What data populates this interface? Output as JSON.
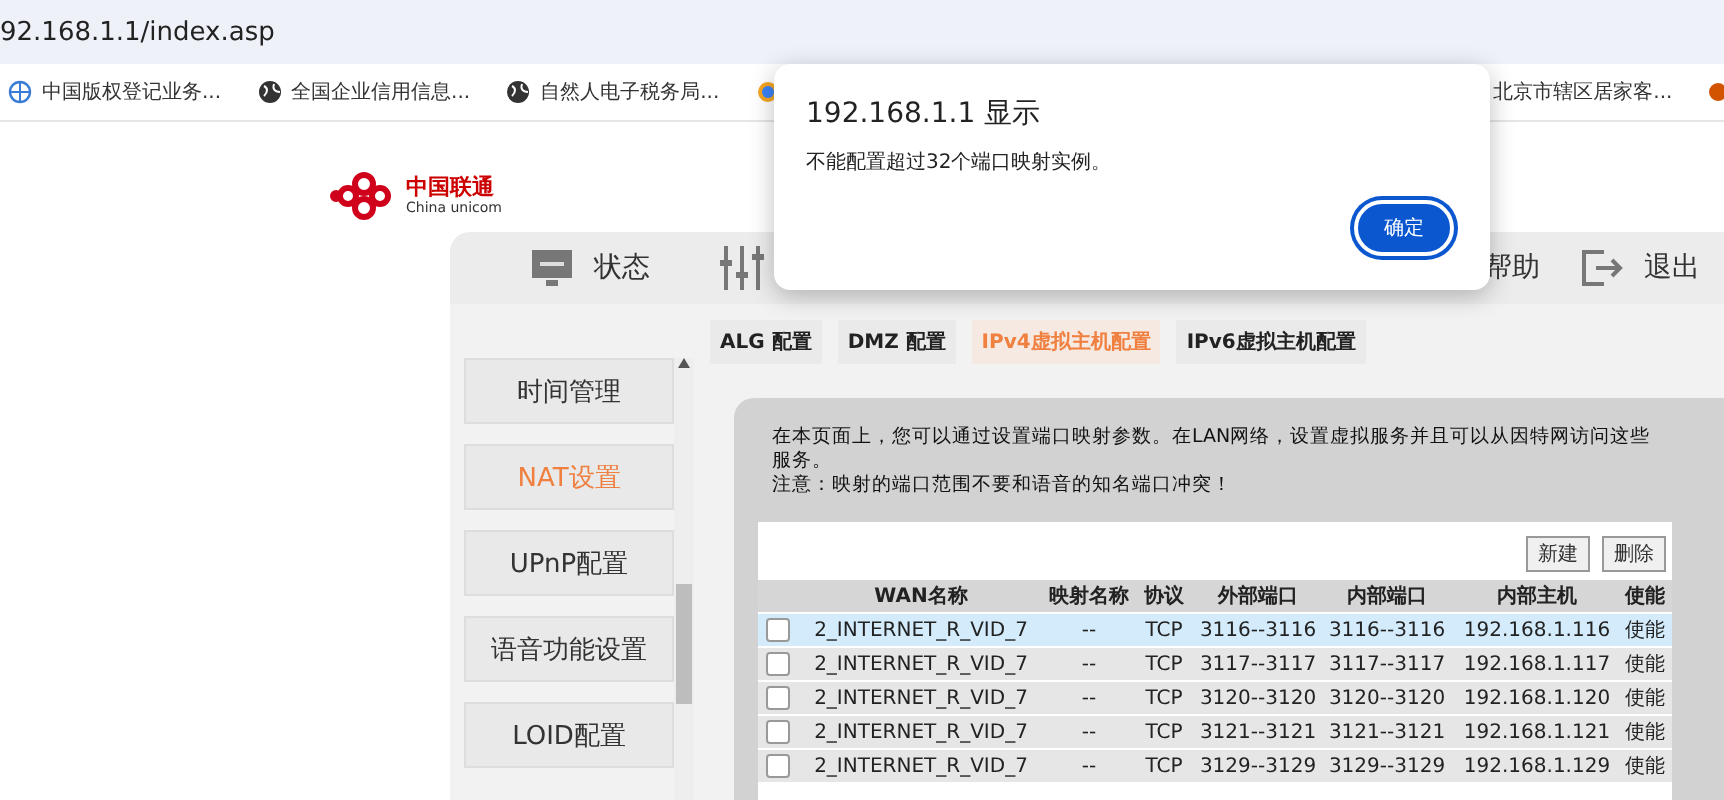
{
  "browser": {
    "url": "92.168.1.1/index.asp",
    "bookmarks": [
      {
        "kind": "globe-blue",
        "label": "中国版权登记业务..."
      },
      {
        "kind": "globe",
        "label": "全国企业信用信息..."
      },
      {
        "kind": "globe",
        "label": "自然人电子税务局..."
      },
      {
        "kind": "swirl"
      },
      {
        "kind": "flower",
        "label": "北京市辖区居家客..."
      },
      {
        "kind": "dot"
      }
    ]
  },
  "brand": {
    "name": "中国联通",
    "subtitle": "China unicom"
  },
  "nav": [
    {
      "kind": "monitor",
      "label": "状态"
    },
    {
      "kind": "sliders"
    },
    {
      "kind": "plain",
      "label": "帮助"
    },
    {
      "kind": "exit",
      "label": "退出"
    }
  ],
  "subtabs": [
    {
      "label": "ALG 配置",
      "selected": false
    },
    {
      "label": "DMZ 配置",
      "selected": false
    },
    {
      "label": "IPv4虚拟主机配置",
      "selected": true
    },
    {
      "label": "IPv6虚拟主机配置",
      "selected": false
    }
  ],
  "sidebar": {
    "items": [
      {
        "label": "时间管理",
        "selected": false
      },
      {
        "label": "NAT设置",
        "selected": true
      },
      {
        "label": "UPnP配置",
        "selected": false
      },
      {
        "label": "语音功能设置",
        "selected": false
      },
      {
        "label": "LOID配置",
        "selected": false
      }
    ]
  },
  "intro": [
    "在本页面上，您可以通过设置端口映射参数。在LAN网络，设置虚拟服务并且可以从因特网访问这些服务。",
    "注意：映射的端口范围不要和语音的知名端口冲突！"
  ],
  "actions": [
    "新建",
    "删除"
  ],
  "table": {
    "columns": [
      "WAN名称",
      "映射名称",
      "协议",
      "外部端口",
      "内部端口",
      "内部主机",
      "使能"
    ],
    "rows": [
      {
        "selected": true,
        "checked": false,
        "cells": [
          "2_INTERNET_R_VID_7",
          "--",
          "TCP",
          "3116--3116",
          "3116--3116",
          "192.168.1.116",
          "使能"
        ]
      },
      {
        "selected": false,
        "checked": false,
        "cells": [
          "2_INTERNET_R_VID_7",
          "--",
          "TCP",
          "3117--3117",
          "3117--3117",
          "192.168.1.117",
          "使能"
        ]
      },
      {
        "selected": false,
        "checked": false,
        "cells": [
          "2_INTERNET_R_VID_7",
          "--",
          "TCP",
          "3120--3120",
          "3120--3120",
          "192.168.1.120",
          "使能"
        ]
      },
      {
        "selected": false,
        "checked": false,
        "cells": [
          "2_INTERNET_R_VID_7",
          "--",
          "TCP",
          "3121--3121",
          "3121--3121",
          "192.168.1.121",
          "使能"
        ]
      },
      {
        "selected": false,
        "checked": false,
        "cells": [
          "2_INTERNET_R_VID_7",
          "--",
          "TCP",
          "3129--3129",
          "3129--3129",
          "192.168.1.129",
          "使能"
        ]
      }
    ]
  },
  "dialog": {
    "title": "192.168.1.1 显示",
    "message": "不能配置超过32个端口映射实例。",
    "button": "确定"
  }
}
